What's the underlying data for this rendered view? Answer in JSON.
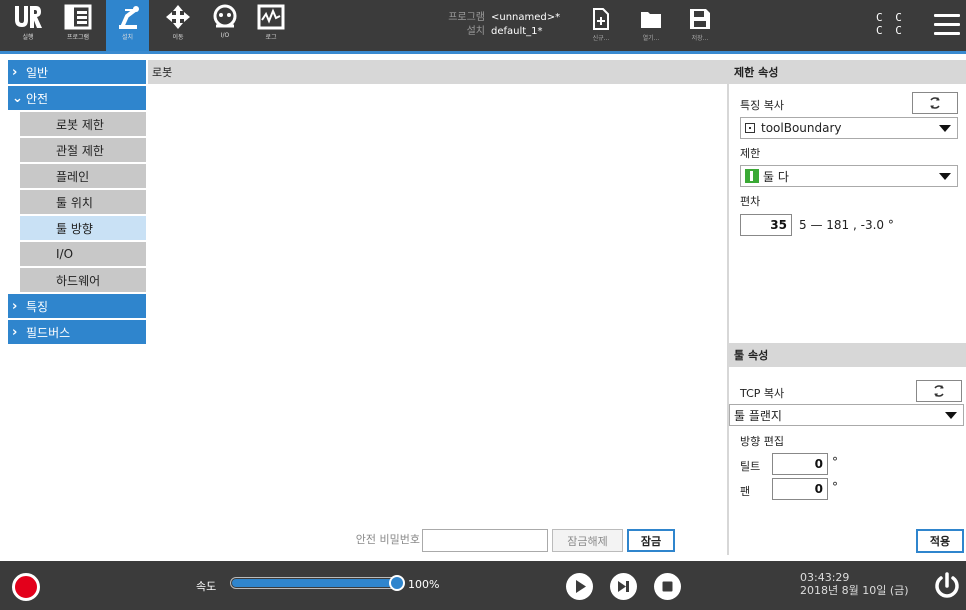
{
  "colors": {
    "accent": "#2f85cd",
    "topbar": "#3b3b3b",
    "estop": "#e3001b",
    "green": "#3aa935"
  },
  "topbar": {
    "tabs": [
      {
        "label": "실행",
        "icon": "ur-logo-icon"
      },
      {
        "label": "프로그램",
        "icon": "program-icon"
      },
      {
        "label": "설치",
        "icon": "robot-arm-icon"
      },
      {
        "label": "이동",
        "icon": "move-arrows-icon"
      },
      {
        "label": "I/O",
        "icon": "io-icon"
      },
      {
        "label": "로그",
        "icon": "log-icon"
      }
    ],
    "program_key": "프로그램",
    "program_value": "<unnamed>*",
    "install_key": "설치",
    "install_value": "default_1*",
    "file_new": "신규...",
    "file_open": "열기...",
    "file_save": "저장...",
    "cc_line1": "C C",
    "cc_line2": "C C"
  },
  "sidebar": {
    "general": "일반",
    "safety": "안전",
    "safety_items": [
      "로봇 제한",
      "관절 제한",
      "플레인",
      "툴 위치",
      "툴 방향",
      "I/O",
      "하드웨어"
    ],
    "selected": "툴 방향",
    "features": "특징",
    "fieldbus": "필드버스"
  },
  "main": {
    "header": "로봇"
  },
  "limit_props": {
    "header": "제한 속성",
    "copy_feature_label": "특징 복사",
    "feature_dropdown": "toolBoundary",
    "restriction_label": "제한",
    "restriction_dropdown": "둘 다",
    "deviation_label": "편차",
    "deviation_value": "35",
    "deviation_range": "5 — 181 , -3.0 °"
  },
  "tool_props": {
    "header": "툴 속성",
    "tcp_copy_label": "TCP 복사",
    "tcp_dropdown": "툴 플랜지",
    "orient_label": "방향 편집",
    "tilt_label": "틸트",
    "tilt_value": "0",
    "pan_label": "팬",
    "pan_value": "0",
    "degree": "°"
  },
  "password": {
    "label": "안전 비밀번호",
    "value": "",
    "unlock": "잠금해제",
    "lock": "잠금"
  },
  "apply": "적용",
  "footer": {
    "speed_label": "속도",
    "speed_percent": 100,
    "speed_text": "100%",
    "time": "03:43:29",
    "date": "2018년 8월 10일 (금)"
  }
}
